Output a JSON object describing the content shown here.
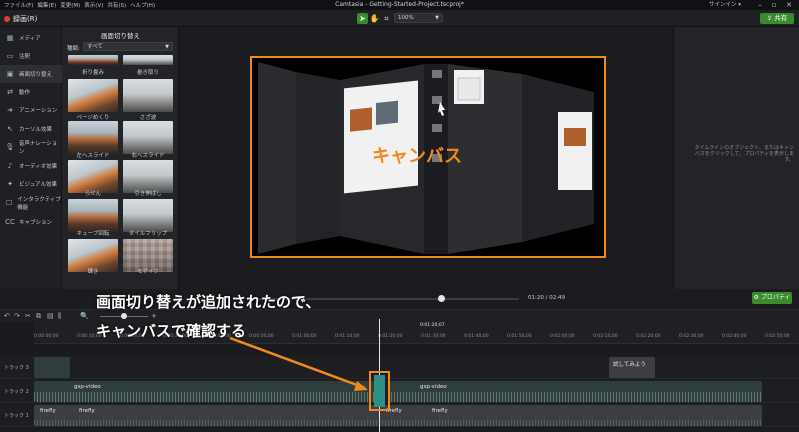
{
  "menu": [
    "ファイル(F)",
    "編集(E)",
    "変更(M)",
    "表示(V)",
    "共有(S)",
    "ヘルプ(H)"
  ],
  "app_title": "Camtasia - Getting-Started-Project.tscproj*",
  "signin": "サインイン ▾",
  "toolbar": {
    "record_label": "録画(R)",
    "zoom_value": "100%",
    "share_label": "共有"
  },
  "nav": [
    "メディア",
    "注釈",
    "画面切り替え",
    "動作",
    "アニメーション",
    "カーソル効果",
    "音声ナレーション",
    "オーディオ効果",
    "ビジュアル効果",
    "インタラクティブ機能",
    "キャプション"
  ],
  "panel": {
    "title": "画面切り替え",
    "type_label": "種類:",
    "type_value": "すべて",
    "thumb_labels": [
      "折り畳み",
      "巻き取り",
      "ページめくり",
      "さざ波",
      "左へスライド",
      "右へスライド",
      "らせん",
      "引き伸ばし",
      "キューブ回転",
      "タイルフリップ",
      "輝き",
      "モザイク"
    ]
  },
  "canvas_label": "キャンバス",
  "props_hint": "タイムラインのオブジェクト、またはキャンバスをクリックして、プロパティを表示します。",
  "playback": {
    "time": "01:20 / 02:49",
    "props_button": "プロパティ"
  },
  "timeline": {
    "playhead_time": "0:01:20;07",
    "ticks": [
      "0:00:00;00",
      "0:00:10;00",
      "0:00:20;00",
      "0:00:30;00",
      "0:00:40;00",
      "0:00:50;00",
      "0:01:00;00",
      "0:01:10;00",
      "0:01:20;00",
      "0:01:30;00",
      "0:01:40;00",
      "0:01:50;00",
      "0:02:00;00",
      "0:02:10;00",
      "0:02:20;00",
      "0:02:30;00",
      "0:02:40;00",
      "0:02:50;00"
    ],
    "track_labels": [
      "トラック 3",
      "トラック 2",
      "トラック 1"
    ],
    "clips": {
      "gsp1": "gsp-video",
      "gsp2": "gsp-video",
      "firefly": "firefly",
      "text": "試してみよう"
    }
  },
  "annotation": [
    "画面切り替えが追加されたので、",
    "キャンバスで確認する"
  ],
  "colors": {
    "accent_orange": "#f08a1c",
    "share_green": "#3a8a2e",
    "record_red": "#e23b3b"
  }
}
